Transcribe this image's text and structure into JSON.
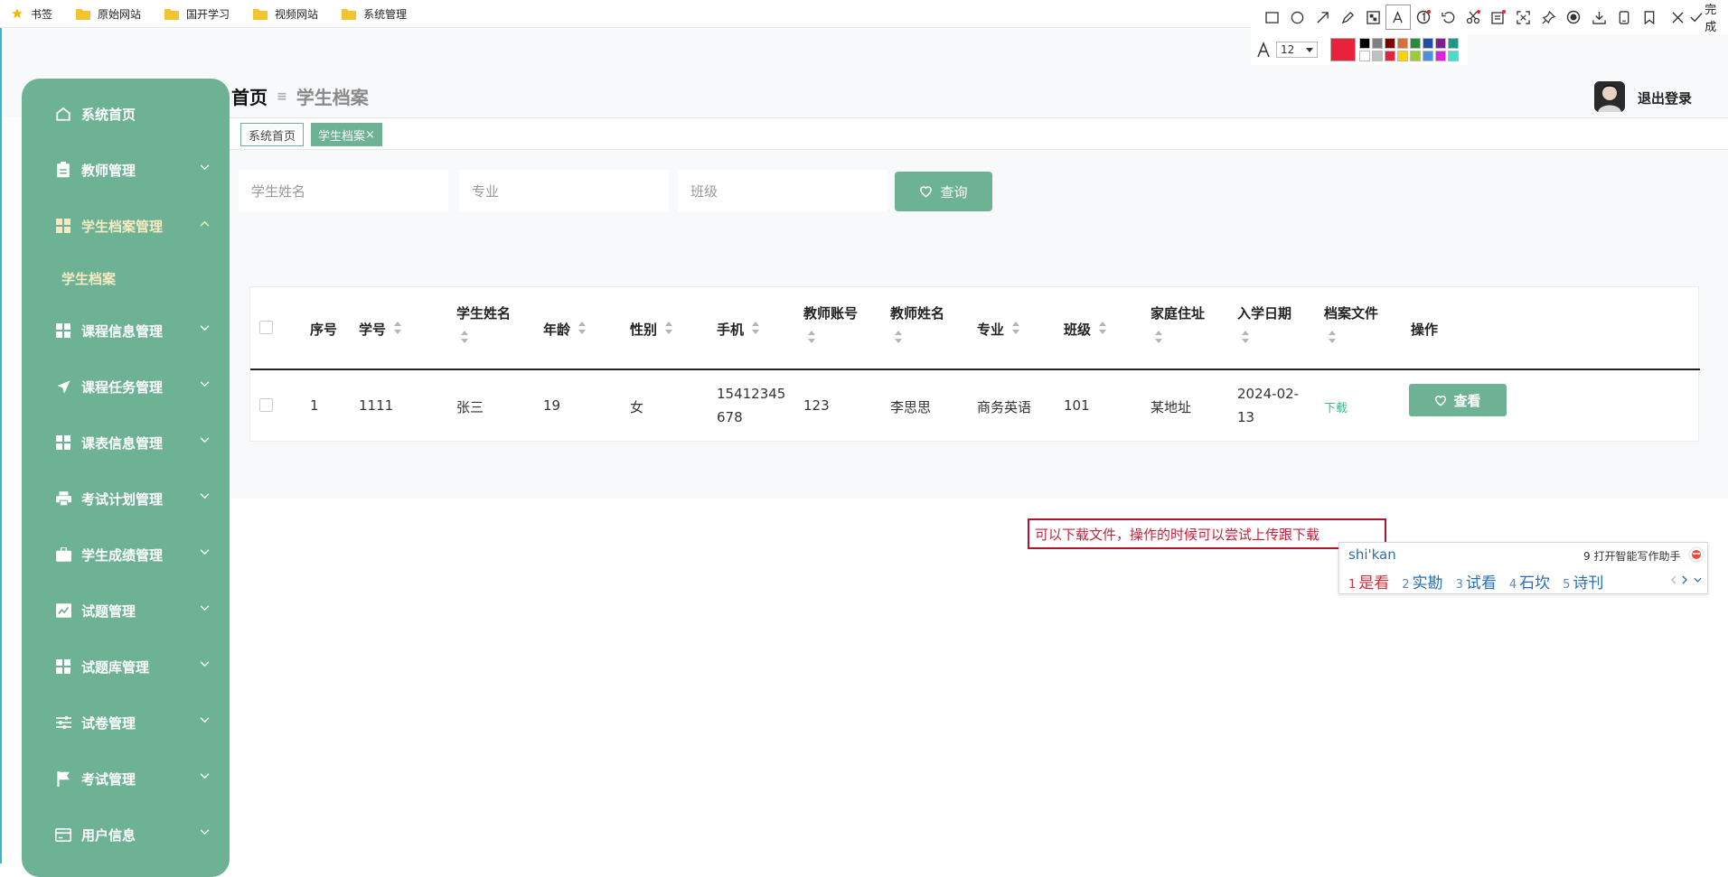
{
  "bookmarks": {
    "items": [
      "书签",
      "原始网站",
      "国开学习",
      "视频网站",
      "系统管理"
    ]
  },
  "sidebar": {
    "items": [
      {
        "label": "系统首页",
        "icon": "home-icon"
      },
      {
        "label": "教师管理",
        "icon": "clipboard-icon"
      },
      {
        "label": "学生档案管理",
        "icon": "grid-icon"
      },
      {
        "label": "课程信息管理",
        "icon": "grid-icon"
      },
      {
        "label": "课程任务管理",
        "icon": "send-icon"
      },
      {
        "label": "课表信息管理",
        "icon": "grid-icon"
      },
      {
        "label": "考试计划管理",
        "icon": "printer-icon"
      },
      {
        "label": "学生成绩管理",
        "icon": "briefcase-icon"
      },
      {
        "label": "试题管理",
        "icon": "chart-icon"
      },
      {
        "label": "试题库管理",
        "icon": "grid-icon"
      },
      {
        "label": "试卷管理",
        "icon": "sliders-icon"
      },
      {
        "label": "考试管理",
        "icon": "flag-icon"
      },
      {
        "label": "用户信息",
        "icon": "card-icon"
      }
    ],
    "sub_item": "学生档案"
  },
  "breadcrumb": {
    "home": "首页",
    "current": "学生档案"
  },
  "tabs": {
    "home": "系统首页",
    "active": "学生档案",
    "close": "×"
  },
  "search": {
    "name_placeholder": "学生姓名",
    "major_placeholder": "专业",
    "class_placeholder": "班级",
    "query_label": "查询"
  },
  "table": {
    "headers": {
      "index": "序号",
      "student_no": "学号",
      "student_name": "学生姓名",
      "age": "年龄",
      "gender": "性别",
      "phone": "手机",
      "teacher_account": "教师账号",
      "teacher_name": "教师姓名",
      "major": "专业",
      "class": "班级",
      "address": "家庭住址",
      "enroll_date": "入学日期",
      "file": "档案文件",
      "action": "操作"
    },
    "rows": [
      {
        "index": "1",
        "student_no": "1111",
        "student_name": "张三",
        "age": "19",
        "gender": "女",
        "phone_l1": "15412345",
        "phone_l2": "678",
        "teacher_account": "123",
        "teacher_name": "李思思",
        "major": "商务英语",
        "class": "101",
        "address": "某地址",
        "date_l1": "2024-02-",
        "date_l2": "13",
        "file": "下载",
        "action": "查看"
      }
    ]
  },
  "header": {
    "logout": "退出登录"
  },
  "screenshot_tool": {
    "done": "完成",
    "font_size": "12",
    "current_color": "#e8223a"
  },
  "annotation": {
    "text": "可以下载文件，操作的时候可以尝试上传跟下载"
  },
  "ime": {
    "pinyin": "shi'kan",
    "hint": "9 打开智能写作助手",
    "candidates": [
      {
        "n": "1",
        "t": "是看"
      },
      {
        "n": "2",
        "t": "实勘"
      },
      {
        "n": "3",
        "t": "试看"
      },
      {
        "n": "4",
        "t": "石坎"
      },
      {
        "n": "5",
        "t": "诗刊"
      }
    ]
  },
  "colors": {
    "accent": "#6db295",
    "sub_text": "#f7e9c0",
    "download": "#3fbf88",
    "annot": "#b2142d"
  }
}
